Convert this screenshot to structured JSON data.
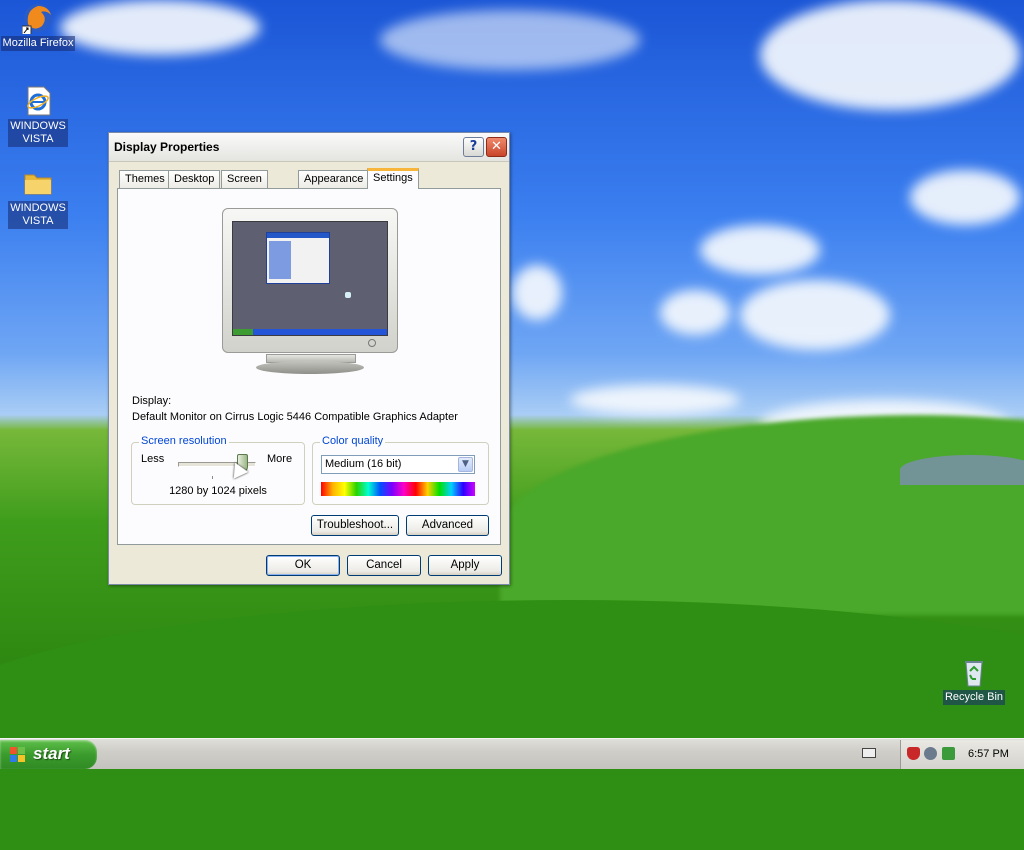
{
  "desktop": {
    "icons": [
      {
        "label": "Mozilla Firefox",
        "icon": "firefox-icon"
      },
      {
        "label": "WINDOWS VISTA",
        "icon": "internet-explorer-icon"
      },
      {
        "label": "WINDOWS VISTA",
        "icon": "folder-icon"
      },
      {
        "label": "Recycle Bin",
        "icon": "recycle-bin-icon"
      }
    ]
  },
  "dialog": {
    "title": "Display Properties",
    "help_glyph": "?",
    "close_glyph": "✕",
    "tabs": [
      {
        "label": "Themes"
      },
      {
        "label": "Desktop"
      },
      {
        "label": "Screen Saver"
      },
      {
        "label": "Appearance"
      },
      {
        "label": "Settings",
        "active": true
      }
    ],
    "display_label": "Display:",
    "display_value": "Default Monitor on Cirrus Logic 5446 Compatible Graphics Adapter",
    "resolution": {
      "group_title": "Screen resolution",
      "less_label": "Less",
      "more_label": "More",
      "value": "1280 by 1024 pixels",
      "slider_position": 0.85
    },
    "color_quality": {
      "group_title": "Color quality",
      "selected": "Medium (16 bit)"
    },
    "buttons": {
      "troubleshoot": "Troubleshoot...",
      "advanced": "Advanced",
      "ok": "OK",
      "cancel": "Cancel",
      "apply": "Apply"
    }
  },
  "taskbar": {
    "start_label": "start",
    "clock": "6:57 PM"
  }
}
